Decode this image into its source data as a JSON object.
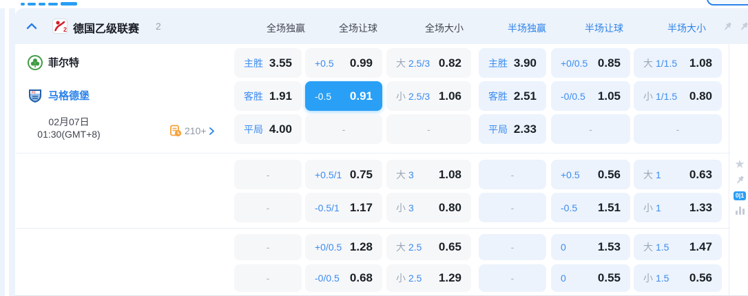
{
  "colors": {
    "accent_blue": "#2b82ea",
    "selected_blue": "#29a0f6",
    "orange": "#f7a23b"
  },
  "league_header": {
    "name": "德国乙级联赛",
    "count": "2",
    "columns": [
      "全场独赢",
      "全场让球",
      "全场大小",
      "半场独赢",
      "半场让球",
      "半场大小"
    ]
  },
  "match": {
    "home_team": "菲尔特",
    "away_team": "马格德堡",
    "date": "02月07日",
    "time": "01:30(GMT+8)",
    "markets_count": "210+"
  },
  "side_rail": {
    "badge": "0|1"
  },
  "odds_sections": [
    {
      "rows": [
        {
          "cells": [
            {
              "label": "主胜",
              "value": "3.55"
            },
            {
              "label": "+0.5",
              "value": "0.99"
            },
            {
              "big": "大",
              "line": "2.5/3",
              "value": "0.82"
            },
            {
              "label": "主胜",
              "value": "3.90"
            },
            {
              "label": "+0/0.5",
              "value": "0.85"
            },
            {
              "big": "大",
              "line": "1/1.5",
              "value": "1.08"
            }
          ]
        },
        {
          "cells": [
            {
              "label": "客胜",
              "value": "1.91"
            },
            {
              "label": "-0.5",
              "value": "0.91",
              "selected": true
            },
            {
              "big": "小",
              "line": "2.5/3",
              "value": "1.06"
            },
            {
              "label": "客胜",
              "value": "2.51"
            },
            {
              "label": "-0/0.5",
              "value": "1.05"
            },
            {
              "big": "小",
              "line": "1/1.5",
              "value": "0.80"
            }
          ]
        },
        {
          "cells": [
            {
              "label": "平局",
              "value": "4.00"
            },
            {
              "dash": true
            },
            {
              "dash": true
            },
            {
              "label": "平局",
              "value": "2.33"
            },
            {
              "dash": true
            },
            {
              "dash": true
            }
          ]
        }
      ]
    },
    {
      "rows": [
        {
          "cells": [
            {
              "dash": true
            },
            {
              "label": "+0.5/1",
              "value": "0.75"
            },
            {
              "big": "大",
              "line": "3",
              "value": "1.08"
            },
            {
              "dash": true
            },
            {
              "label": "+0.5",
              "value": "0.56"
            },
            {
              "big": "大",
              "line": "1",
              "value": "0.63"
            }
          ]
        },
        {
          "cells": [
            {
              "dash": true
            },
            {
              "label": "-0.5/1",
              "value": "1.17"
            },
            {
              "big": "小",
              "line": "3",
              "value": "0.80"
            },
            {
              "dash": true
            },
            {
              "label": "-0.5",
              "value": "1.51"
            },
            {
              "big": "小",
              "line": "1",
              "value": "1.33"
            }
          ]
        }
      ]
    },
    {
      "rows": [
        {
          "cells": [
            {
              "dash": true
            },
            {
              "label": "+0/0.5",
              "value": "1.28"
            },
            {
              "big": "大",
              "line": "2.5",
              "value": "0.65"
            },
            {
              "dash": true
            },
            {
              "label": "0",
              "value": "1.53"
            },
            {
              "big": "大",
              "line": "1.5",
              "value": "1.47"
            }
          ]
        },
        {
          "cells": [
            {
              "dash": true
            },
            {
              "label": "-0/0.5",
              "value": "0.68"
            },
            {
              "big": "小",
              "line": "2.5",
              "value": "1.29"
            },
            {
              "dash": true
            },
            {
              "label": "0",
              "value": "0.55"
            },
            {
              "big": "小",
              "line": "1.5",
              "value": "0.56"
            }
          ]
        }
      ]
    }
  ]
}
